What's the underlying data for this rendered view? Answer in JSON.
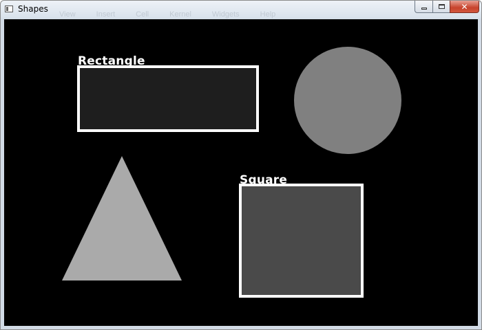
{
  "window": {
    "title": "Shapes",
    "background_menu_ghost": [
      "View",
      "Insert",
      "Cell",
      "Kernel",
      "Widgets",
      "Help"
    ],
    "controls": {
      "minimize": "minimize",
      "maximize": "maximize",
      "close": "✕"
    }
  },
  "canvas": {
    "background": "#000000",
    "labels": {
      "rectangle": "Rectangle",
      "square": "Square"
    },
    "shapes": [
      {
        "kind": "rectangle",
        "fill": "#1e1e1e",
        "outline": "#ffffff"
      },
      {
        "kind": "circle",
        "fill": "#808080"
      },
      {
        "kind": "triangle",
        "fill": "#aaaaaa"
      },
      {
        "kind": "square",
        "fill": "#4a4a4a",
        "outline": "#ffffff"
      }
    ]
  }
}
